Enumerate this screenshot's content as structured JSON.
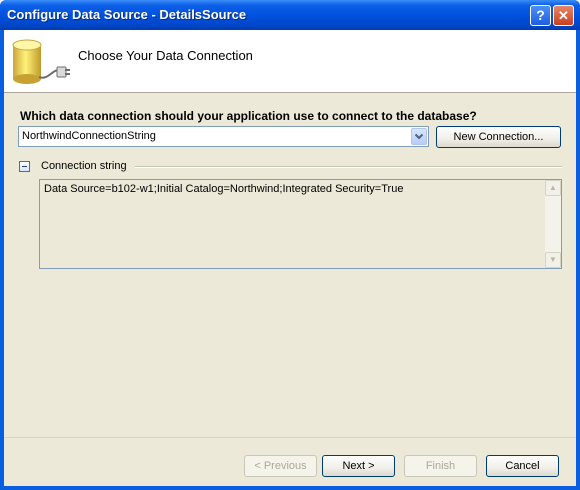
{
  "window": {
    "title": "Configure Data Source - DetailsSource"
  },
  "titlebar_buttons": {
    "help": "?",
    "close": "✕"
  },
  "header": {
    "title": "Choose Your Data Connection",
    "icon": "database-plug-icon"
  },
  "connection": {
    "question": "Which data connection should your application use to connect to the database?",
    "selected": "NorthwindConnectionString",
    "new_button": "New Connection..."
  },
  "connection_string": {
    "label": "Connection string",
    "value": "Data Source=b102-w1;Initial Catalog=Northwind;Integrated Security=True",
    "expanded": true
  },
  "footer": {
    "previous": "< Previous",
    "next": "Next >",
    "finish": "Finish",
    "cancel": "Cancel"
  },
  "colors": {
    "titlebar": "#0054e3",
    "dialog": "#ece9d8",
    "header": "#ffffff"
  }
}
